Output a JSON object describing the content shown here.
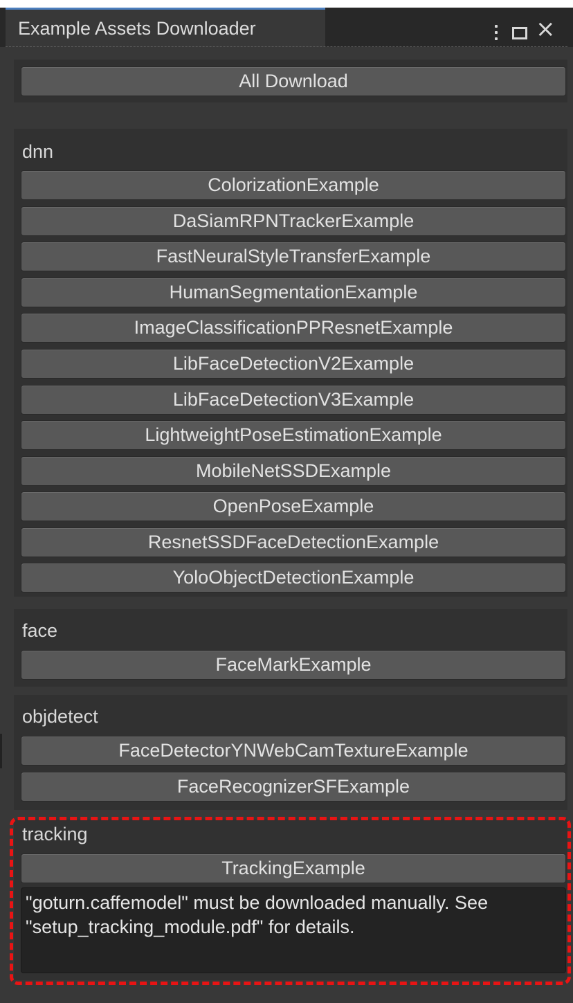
{
  "window": {
    "title": "Example Assets Downloader",
    "menu_icon": "vertical-ellipsis-icon",
    "maximize_icon": "maximize-icon",
    "close_icon": "close-icon",
    "close_glyph": "×"
  },
  "all_download": {
    "label": "All Download"
  },
  "sections": [
    {
      "header": "dnn",
      "buttons": [
        "ColorizationExample",
        "DaSiamRPNTrackerExample",
        "FastNeuralStyleTransferExample",
        "HumanSegmentationExample",
        "ImageClassificationPPResnetExample",
        "LibFaceDetectionV2Example",
        "LibFaceDetectionV3Example",
        "LightweightPoseEstimationExample",
        "MobileNetSSDExample",
        "OpenPoseExample",
        "ResnetSSDFaceDetectionExample",
        "YoloObjectDetectionExample"
      ]
    },
    {
      "header": "face",
      "buttons": [
        "FaceMarkExample"
      ]
    },
    {
      "header": "objdetect",
      "buttons": [
        "FaceDetectorYNWebCamTextureExample",
        "FaceRecognizerSFExample"
      ]
    },
    {
      "header": "tracking",
      "buttons": [
        "TrackingExample"
      ],
      "note": "\"goturn.caffemodel\" must be downloaded manually. See \"setup_tracking_module.pdf\" for details."
    }
  ],
  "colors": {
    "background": "#383838",
    "section": "#313131",
    "button": "#585858",
    "tab_accent": "#4c7fbe",
    "highlight": "#e81414"
  }
}
